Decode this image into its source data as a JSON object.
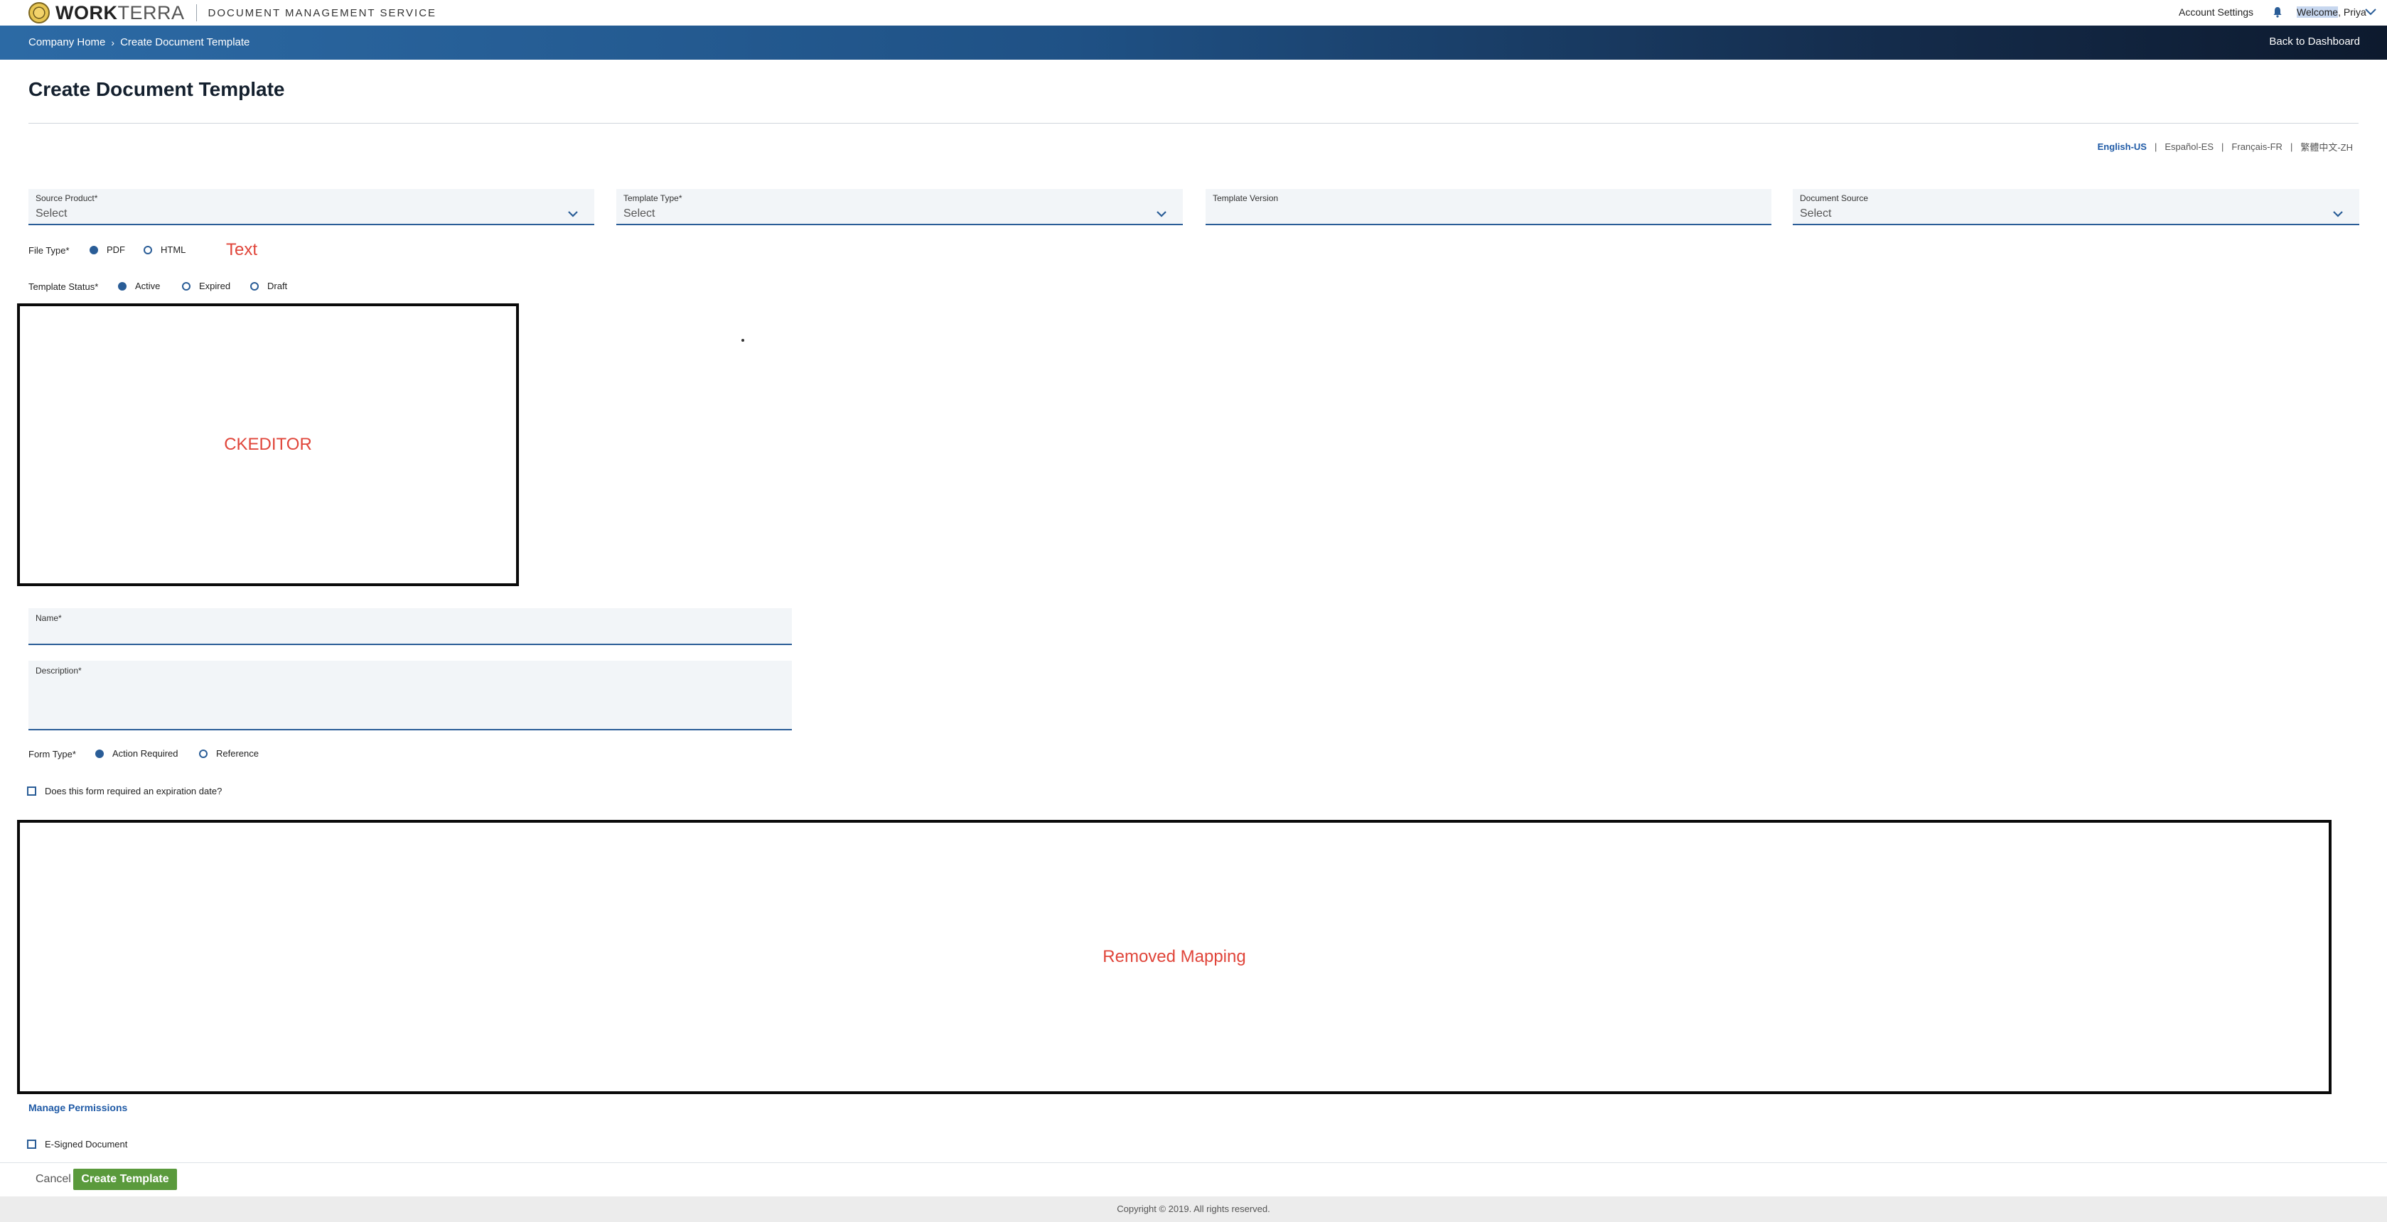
{
  "header": {
    "brand_bold": "WORK",
    "brand_light": "TERRA",
    "service": "DOCUMENT MANAGEMENT SERVICE",
    "account_settings": "Account Settings",
    "welcome_word": "Welcome",
    "welcome_rest": ", Priya"
  },
  "breadcrumb": {
    "items": [
      "Company Home",
      "Create Document Template"
    ],
    "separator": "›",
    "back_link": "Back to Dashboard"
  },
  "page": {
    "title": "Create Document Template"
  },
  "languages": {
    "items": [
      "English-US",
      "Español-ES",
      "Français-FR",
      "繁體中文-ZH"
    ],
    "active": "English-US"
  },
  "fields": {
    "source_product": {
      "label": "Source Product*",
      "value": "Select"
    },
    "template_type": {
      "label": "Template Type*",
      "value": "Select"
    },
    "template_version": {
      "label": "Template Version",
      "value": ""
    },
    "document_source": {
      "label": "Document Source",
      "value": "Select"
    }
  },
  "file_type": {
    "label": "File Type*",
    "options": [
      "PDF",
      "HTML"
    ],
    "selected": "PDF",
    "annotation": "Text"
  },
  "template_status": {
    "label": "Template Status*",
    "options": [
      "Active",
      "Expired",
      "Draft"
    ],
    "selected": "Active"
  },
  "editor_placeholder": "CKEDITOR",
  "name_field": {
    "label": "Name*"
  },
  "description_field": {
    "label": "Description*"
  },
  "form_type": {
    "label": "Form Type*",
    "options": [
      "Action Required",
      "Reference"
    ],
    "selected": "Action Required"
  },
  "expiration_checkbox": {
    "label": "Does this form required an expiration date?",
    "checked": false
  },
  "mapping_placeholder": "Removed Mapping",
  "manage_permissions": "Manage Permissions",
  "esigned_checkbox": {
    "label": "E-Signed Document",
    "checked": false
  },
  "actions": {
    "cancel": "Cancel",
    "create": "Create Template"
  },
  "footer": {
    "copyright": "Copyright © 2019. All rights reserved."
  },
  "colors": {
    "accent": "#2a5d97",
    "primary_button": "#5a9a3c",
    "annotation_red": "#e0453a"
  }
}
